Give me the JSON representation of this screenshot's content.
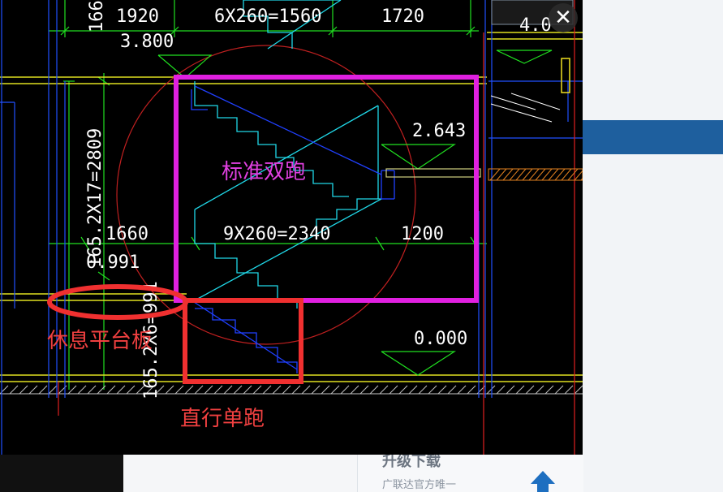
{
  "viewer": {
    "close_icon": "close-icon",
    "close_glyph": "✕"
  },
  "drawing": {
    "dims": {
      "d1920": "1920",
      "d6x260": "6X260=1560",
      "d1720": "1720",
      "d1660": "1660",
      "d9x260": "9X260=2340",
      "d1200": "1200",
      "vert_top": "166.",
      "vert_mid": "165.2X17=2809",
      "vert_bot": "165.2X6=991"
    },
    "elevations": {
      "e3800": "3.800",
      "e2643": "2.643",
      "e0991": "0.991",
      "e0000": "0.000",
      "e4000": "4.0"
    },
    "annotations": {
      "standard_double": "标准双跑",
      "landing_slab": "休息平台板",
      "straight_single": "直行单跑"
    },
    "colors": {
      "magenta_box": "#e020e0",
      "red_box": "#f03030",
      "dim_green": "#20e020",
      "stair_cyan": "#20d8e8",
      "stair_blue": "#2040ff",
      "label_magenta": "#e040e0",
      "label_red": "#f04040"
    }
  },
  "background": {
    "card_title": "升级下载",
    "card_sub": "广联达官方唯一"
  }
}
